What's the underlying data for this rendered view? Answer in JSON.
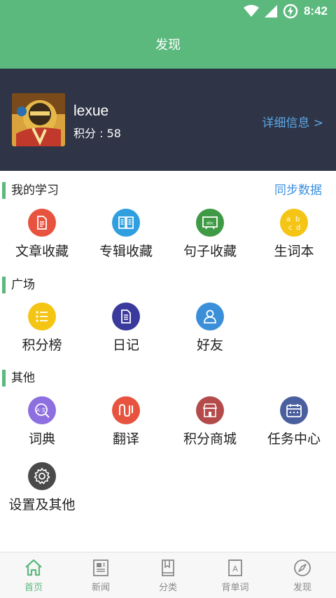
{
  "status_bar": {
    "time": "8:42"
  },
  "header": {
    "title": "发现"
  },
  "profile": {
    "username": "lexue",
    "points": "积分 : 58",
    "detail_link": "详细信息 >"
  },
  "sections": {
    "study": {
      "title": "我的学习",
      "action": "同步数据",
      "items": [
        {
          "label": "文章收藏",
          "icon": "article-icon",
          "color": "#e8533f"
        },
        {
          "label": "专辑收藏",
          "icon": "album-book-icon",
          "color": "#2f9fe0"
        },
        {
          "label": "句子收藏",
          "icon": "blackboard-icon",
          "color": "#3f9a45"
        },
        {
          "label": "生词本",
          "icon": "abcd-icon",
          "color": "#f5c516"
        }
      ]
    },
    "square": {
      "title": "广场",
      "items": [
        {
          "label": "积分榜",
          "icon": "list-icon",
          "color": "#f5c516"
        },
        {
          "label": "日记",
          "icon": "diary-icon",
          "color": "#3a3a9c"
        },
        {
          "label": "好友",
          "icon": "person-icon",
          "color": "#3b8fd9"
        }
      ]
    },
    "other": {
      "title": "其他",
      "items": [
        {
          "label": "词典",
          "icon": "dictionary-search-icon",
          "color": "#8d6fe0"
        },
        {
          "label": "翻译",
          "icon": "translate-wave-icon",
          "color": "#e8533f"
        },
        {
          "label": "积分商城",
          "icon": "shop-icon",
          "color": "#b54a4a"
        },
        {
          "label": "任务中心",
          "icon": "calendar-icon",
          "color": "#4a5f9e"
        },
        {
          "label": "设置及其他",
          "icon": "gear-icon",
          "color": "#4a4a4a"
        }
      ]
    }
  },
  "bottom_nav": [
    {
      "label": "首页",
      "icon": "home-icon",
      "active": true
    },
    {
      "label": "新闻",
      "icon": "news-icon",
      "active": false
    },
    {
      "label": "分类",
      "icon": "category-book-icon",
      "active": false
    },
    {
      "label": "背单词",
      "icon": "word-card-icon",
      "active": false
    },
    {
      "label": "发现",
      "icon": "compass-icon",
      "active": false
    }
  ],
  "colors": {
    "primary": "#5bb97d",
    "profile_bg": "#2f3446",
    "link": "#3a8fe0"
  }
}
